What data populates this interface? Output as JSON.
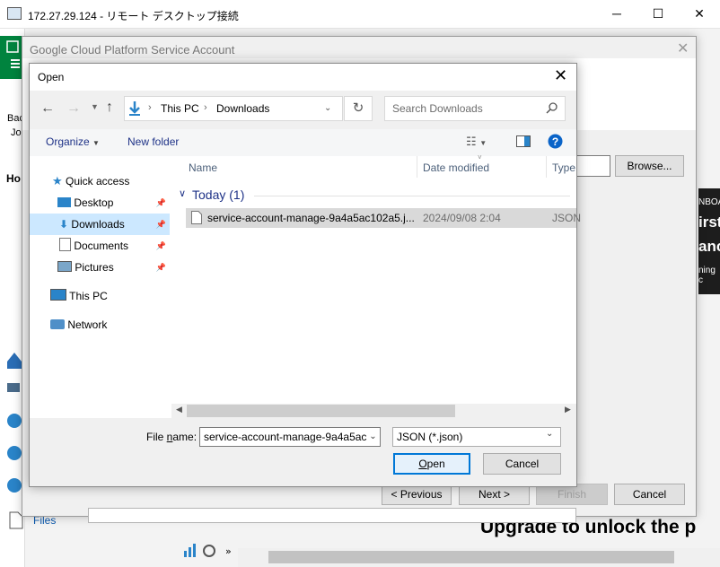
{
  "rdp": {
    "title": "172.27.29.124 - リモート デスクトップ接続",
    "minimize": "─",
    "maximize": "☐",
    "close": "✕"
  },
  "background": {
    "left_items": [
      "Bac",
      "Jo",
      "Ho"
    ],
    "files_label": "Files",
    "dark_panel_lines": [
      "NBOA",
      "irst",
      "anc",
      "ning c"
    ],
    "upgrade_text": "Upgrade to unlock the p"
  },
  "gcp_dialog": {
    "title": "Google Cloud Platform Service Account",
    "browse_label": "Browse...",
    "previous_label": "< Previous",
    "next_label": "Next >",
    "finish_label": "Finish",
    "cancel_label": "Cancel"
  },
  "open_dialog": {
    "title": "Open",
    "address": {
      "root": "This PC",
      "folder": "Downloads"
    },
    "search_placeholder": "Search Downloads",
    "toolbar": {
      "organize": "Organize",
      "new_folder": "New folder"
    },
    "nav": {
      "quick_access": "Quick access",
      "desktop": "Desktop",
      "downloads": "Downloads",
      "documents": "Documents",
      "pictures": "Pictures",
      "this_pc": "This PC",
      "network": "Network"
    },
    "columns": {
      "name": "Name",
      "date_modified": "Date modified",
      "type": "Type"
    },
    "group": "Today (1)",
    "files": [
      {
        "name": "service-account-manage-9a4a5ac102a5.j...",
        "date": "2024/09/08 2:04",
        "type": "JSON"
      }
    ],
    "file_name_label_pre": "File ",
    "file_name_label_ul": "n",
    "file_name_label_post": "ame:",
    "file_name_value": "service-account-manage-9a4a5ac",
    "file_type": "JSON (*.json)",
    "open_ul": "O",
    "open_rest": "pen",
    "cancel_label": "Cancel"
  },
  "colors": {
    "accent": "#0078d7",
    "veeam_green": "#00833e",
    "selected_row": "#d9d9d9",
    "nav_selected": "#cce8ff"
  }
}
